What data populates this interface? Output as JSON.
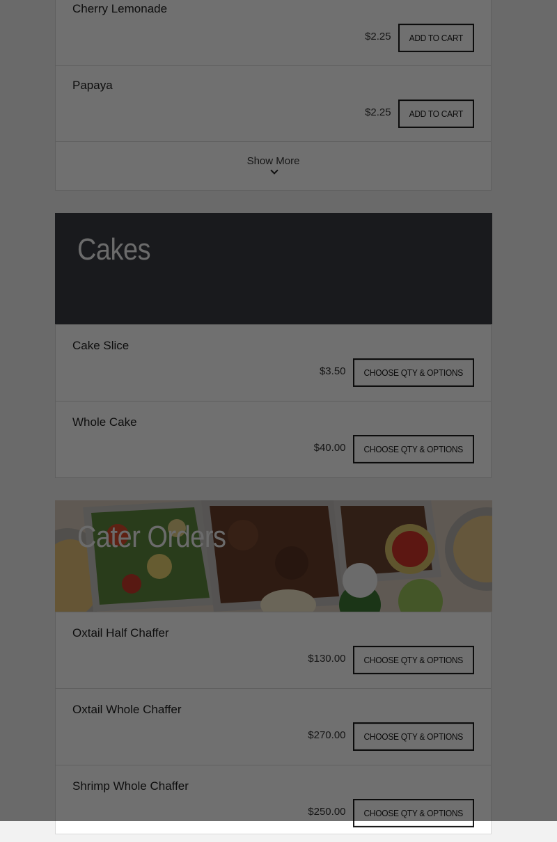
{
  "colors": {
    "page_bg": "#f2f2f2",
    "card_bg": "#ffffff",
    "cakes_banner_bg": "#3a3d42",
    "overlay": "rgba(0,0,0,0.56)"
  },
  "drinks": {
    "items": [
      {
        "name": "Cherry Lemonade",
        "price": "$2.25",
        "button": "ADD TO CART"
      },
      {
        "name": "Papaya",
        "price": "$2.25",
        "button": "ADD TO CART"
      }
    ],
    "show_more": "Show More",
    "show_more_icon": "chevron-down-icon"
  },
  "cakes": {
    "title": "Cakes",
    "items": [
      {
        "name": "Cake Slice",
        "price": "$3.50",
        "button": "CHOOSE QTY & OPTIONS"
      },
      {
        "name": "Whole Cake",
        "price": "$40.00",
        "button": "CHOOSE QTY & OPTIONS"
      }
    ]
  },
  "cater": {
    "title": "Cater Orders",
    "banner_image": "catering-trays-photo",
    "items": [
      {
        "name": "Oxtail Half Chaffer",
        "price": "$130.00",
        "button": "CHOOSE QTY & OPTIONS"
      },
      {
        "name": "Oxtail Whole Chaffer",
        "price": "$270.00",
        "button": "CHOOSE QTY & OPTIONS"
      },
      {
        "name": "Shrimp Whole Chaffer",
        "price": "$250.00",
        "button": "CHOOSE QTY & OPTIONS"
      }
    ]
  }
}
